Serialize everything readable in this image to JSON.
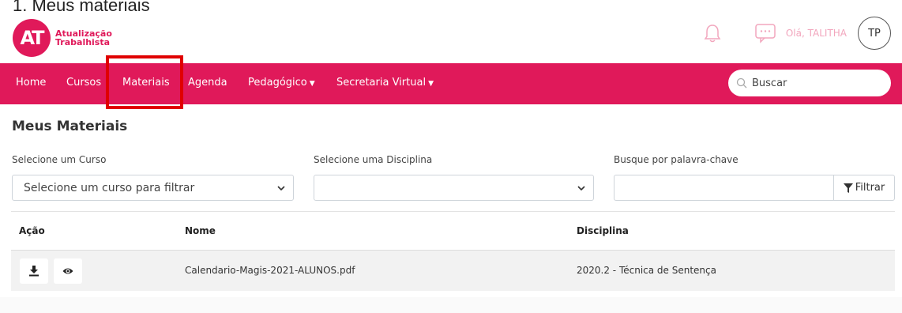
{
  "overlay_caption": "1. Meus materiais",
  "brand": {
    "logo_letters": "AT",
    "name_line1": "Atualização",
    "name_line2": "Trabalhista",
    "color": "#e0195a"
  },
  "header": {
    "greeting": "Olá, TALITHA",
    "avatar_initials": "TP"
  },
  "nav": {
    "home": "Home",
    "cursos": "Cursos",
    "materiais": "Materiais",
    "agenda": "Agenda",
    "pedagogico": "Pedagógico",
    "secretaria": "Secretaria Virtual",
    "search_placeholder": "Buscar"
  },
  "page": {
    "title": "Meus Materiais"
  },
  "filters": {
    "curso_label": "Selecione um Curso",
    "curso_value": "Selecione um curso para filtrar",
    "disciplina_label": "Selecione uma Disciplina",
    "disciplina_value": "",
    "keyword_label": "Busque por palavra-chave",
    "filter_button": "Filtrar"
  },
  "table": {
    "headers": {
      "acao": "Ação",
      "nome": "Nome",
      "disciplina": "Disciplina"
    },
    "rows": [
      {
        "nome": "Calendario-Magis-2021-ALUNOS.pdf",
        "disciplina": "2020.2 - Técnica de Sentença"
      }
    ]
  }
}
